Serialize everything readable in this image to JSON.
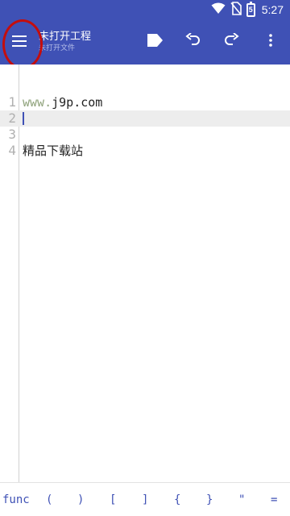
{
  "status_bar": {
    "time": "5:27",
    "battery_level": "5",
    "icons": [
      "wifi-icon",
      "no-sim-icon",
      "battery-icon"
    ]
  },
  "toolbar": {
    "title": "未打开工程",
    "subtitle": "未打开文件",
    "icons": [
      "menu-icon",
      "run-icon",
      "undo-icon",
      "redo-icon",
      "more-vert-icon"
    ],
    "color": "#3f51b5"
  },
  "editor": {
    "lines": [
      {
        "number": "1",
        "prefix": "www.",
        "text": "j9p.com"
      },
      {
        "number": "2",
        "prefix": "",
        "text": ""
      },
      {
        "number": "3",
        "prefix": "",
        "text": ""
      },
      {
        "number": "4",
        "prefix": "",
        "text": "精品下载站"
      }
    ],
    "current_line": 2
  },
  "symbols": [
    "func",
    "(",
    ")",
    "[",
    "]",
    "{",
    "}",
    "\"",
    "="
  ],
  "annotation": {
    "color": "#c40d0d"
  }
}
